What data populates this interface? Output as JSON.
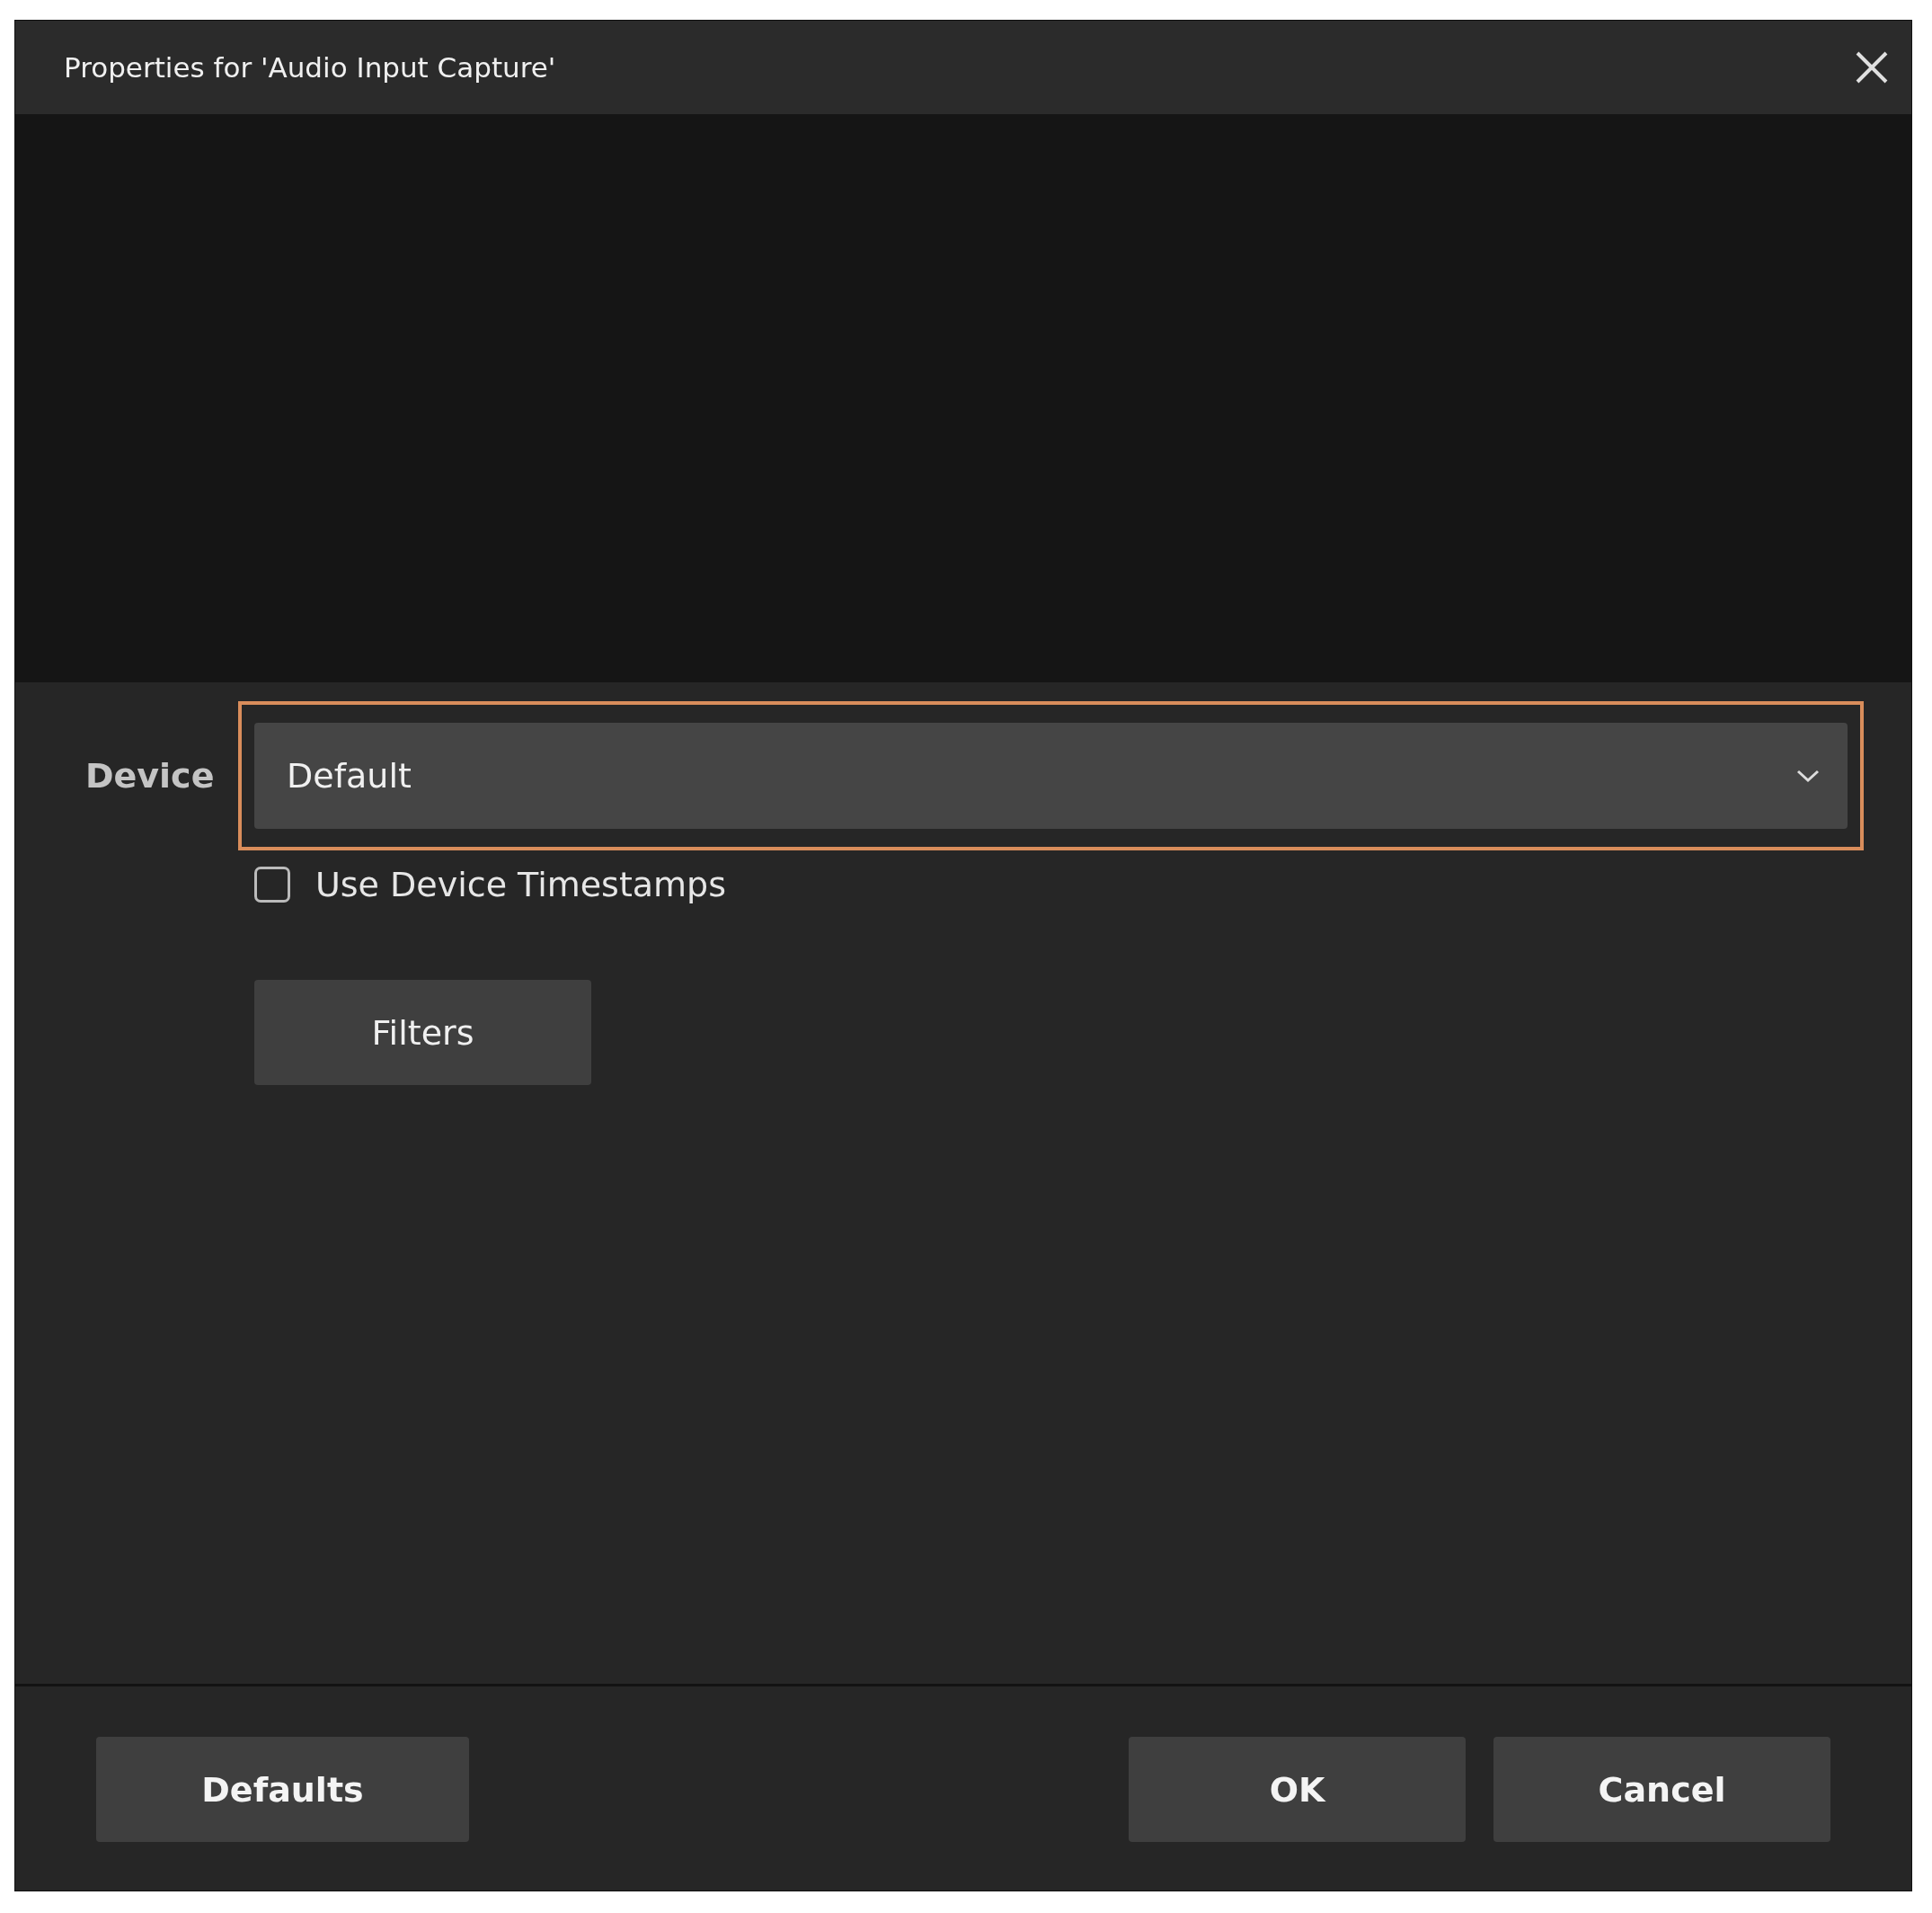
{
  "window": {
    "title": "Properties for 'Audio Input Capture'"
  },
  "device": {
    "label": "Device",
    "value": "Default",
    "focused": true
  },
  "timestamps": {
    "label": "Use Device Timestamps",
    "checked": false
  },
  "filters_button": {
    "label": "Filters"
  },
  "footer": {
    "left_buttons": [
      {
        "label": "Defaults"
      }
    ],
    "right_buttons": [
      {
        "label": "OK"
      },
      {
        "label": "Cancel"
      }
    ]
  }
}
